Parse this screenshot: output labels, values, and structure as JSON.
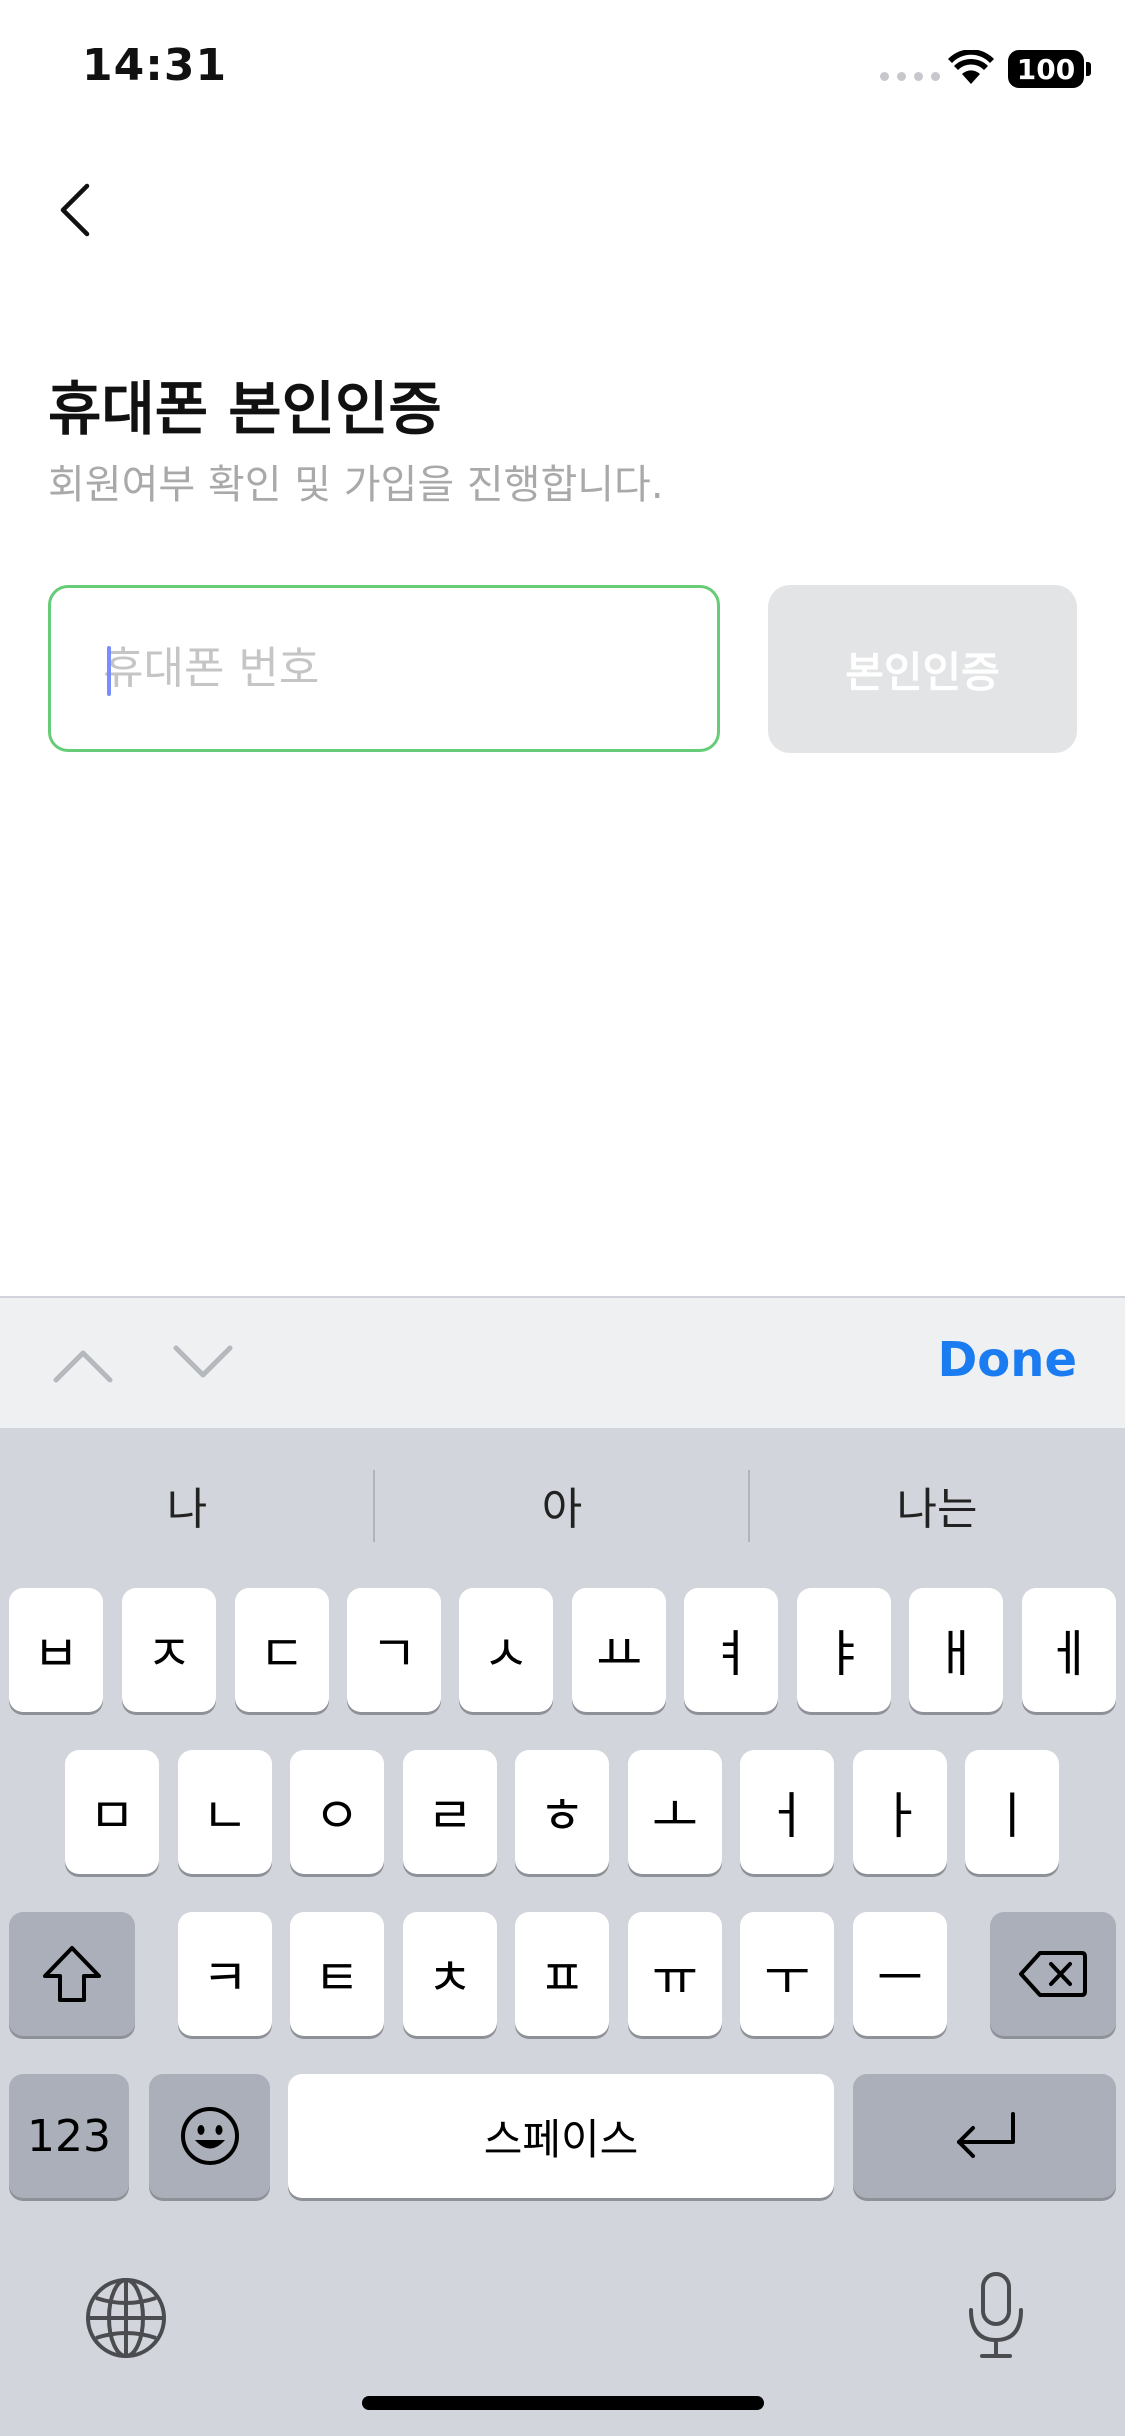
{
  "status_bar": {
    "time": "14:31",
    "battery": "100"
  },
  "header": {
    "back_icon": "chevron-left-icon",
    "title": "휴대폰 본인인증",
    "subtitle": "회원여부 확인 및 가입을 진행합니다."
  },
  "form": {
    "phone_placeholder": "휴대폰 번호",
    "phone_value": "",
    "verify_label": "본인인증"
  },
  "accessory_bar": {
    "done_label": "Done",
    "prev_icon": "chevron-up-icon",
    "next_icon": "chevron-down-icon"
  },
  "keyboard": {
    "suggestions": [
      "나",
      "아",
      "나는"
    ],
    "row1": [
      "ㅂ",
      "ㅈ",
      "ㄷ",
      "ㄱ",
      "ㅅ",
      "ㅛ",
      "ㅕ",
      "ㅑ",
      "ㅐ",
      "ㅔ"
    ],
    "row2": [
      "ㅁ",
      "ㄴ",
      "ㅇ",
      "ㄹ",
      "ㅎ",
      "ㅗ",
      "ㅓ",
      "ㅏ",
      "ㅣ"
    ],
    "row3": [
      "ㅋ",
      "ㅌ",
      "ㅊ",
      "ㅍ",
      "ㅠ",
      "ㅜ",
      "ㅡ"
    ],
    "numbers_label": "123",
    "space_label": "스페이스"
  },
  "colors": {
    "accent": "#1a7cf0",
    "field_border": "#66cc77",
    "button_disabled": "#e3e4e6"
  }
}
